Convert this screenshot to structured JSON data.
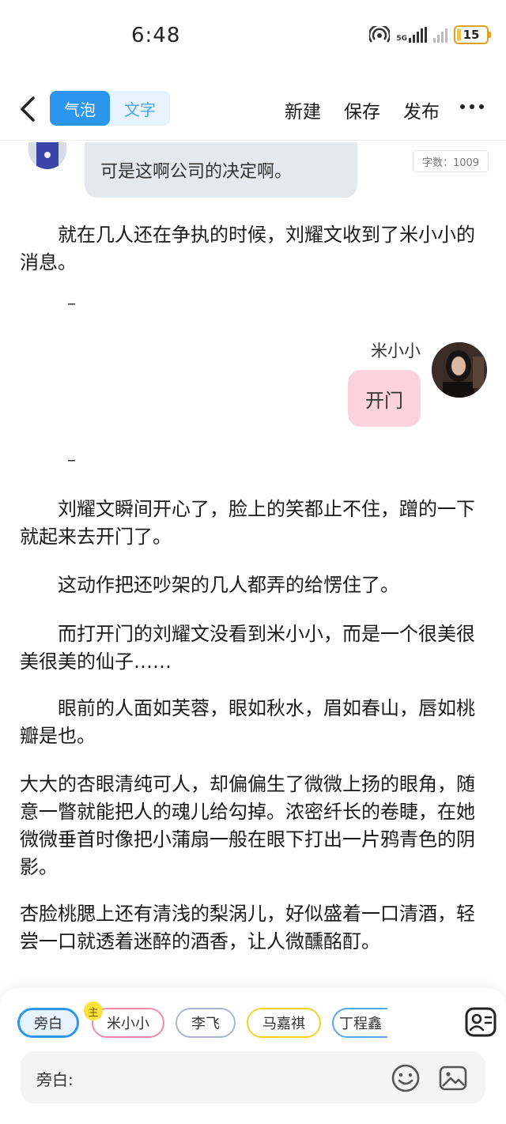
{
  "status_bar": {
    "time": "6:48",
    "network_label": "5G",
    "battery_level": 15,
    "battery_text": "15"
  },
  "toolbar": {
    "modes": [
      "气泡",
      "文字"
    ],
    "active_mode": "气泡",
    "actions": [
      "新建",
      "保存",
      "发布"
    ],
    "more_icon": "more-dots-icon",
    "back_icon": "chevron-left-icon",
    "accent_color": "#2c96ef"
  },
  "content": {
    "word_count": "字数：1009",
    "top_bubble": "可是这啊公司的决定啊。",
    "para1": "　　就在几人还在争执的时候，刘耀文收到了米小小的消息。",
    "dash1": "–",
    "chat": {
      "speaker": "米小小",
      "message": "开门",
      "bubble_color": "#fbd3df"
    },
    "dash2": "–",
    "para2": "　　刘耀文瞬间开心了，脸上的笑都止不住，蹭的一下就起来去开门了。",
    "para3": "　　这动作把还吵架的几人都弄的给愣住了。",
    "para4": "　　而打开门的刘耀文没看到米小小，而是一个很美很美很美的仙子……",
    "para5": "　　眼前的人面如芙蓉，眼如秋水，眉如春山，唇如桃瓣是也。",
    "para6": "大大的杏眼清纯可人，却偏偏生了微微上扬的眼角，随意一瞥就能把人的魂儿给勾掉。浓密纤长的卷睫，在她微微垂首时像把小蒲扇一般在眼下打出一片鸦青色的阴影。",
    "para7": "杏脸桃腮上还有清浅的梨涡儿，好似盛着一口清酒，轻尝一口就透着迷醉的酒香，让人微醺酩酊。"
  },
  "bottom": {
    "owner_badge": "主",
    "roles": [
      {
        "label": "旁白",
        "border": "#2c96ef",
        "bg": "#e7f4ff",
        "selected": true
      },
      {
        "label": "米小小",
        "border": "#f08aa8",
        "bg": "#ffffff",
        "selected": false
      },
      {
        "label": "李飞",
        "border": "#a9b6c9",
        "bg": "#ffffff",
        "selected": false
      },
      {
        "label": "马嘉祺",
        "border": "#f5d229",
        "bg": "#ffffff",
        "selected": false
      },
      {
        "label": "丁程鑫",
        "border": "#5aa7f0",
        "bg": "#ffffff",
        "selected": false
      }
    ],
    "input_label": "旁白:",
    "icons": [
      "contacts-icon",
      "emoji-icon",
      "image-icon"
    ]
  }
}
